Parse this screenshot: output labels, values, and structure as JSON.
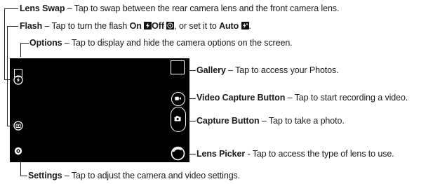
{
  "annotations": {
    "lens_swap": {
      "title": "Lens Swap",
      "desc": " – Tap to swap between the rear camera lens and the front camera lens."
    },
    "flash": {
      "title": "Flash",
      "desc_1": " – Tap to turn the flash ",
      "on_label": "On",
      "off_label": "Off",
      "desc_2": ", or set it to ",
      "auto_label": "Auto",
      "end": "."
    },
    "options": {
      "title": "Options",
      "desc": " – Tap to display and hide the camera options on the screen."
    },
    "gallery": {
      "title": "Gallery",
      "desc": " – Tap to access your Photos."
    },
    "video_capture": {
      "title": "Video Capture Button",
      "desc": " – Tap to start recording a video."
    },
    "capture": {
      "title": "Capture Button",
      "desc": " – Tap to take a photo."
    },
    "lens_picker": {
      "title": "Lens Picker",
      "desc": " - Tap to access the type of lens to use."
    },
    "settings": {
      "title": "Settings",
      "desc": " – Tap to adjust the camera and video settings."
    }
  },
  "icons": {
    "flash_on": "flash-on-icon",
    "flash_off": "flash-off-icon",
    "flash_auto": "flash-auto-icon",
    "options": "options-square-icon",
    "lens_swap": "lens-swap-icon",
    "flash": "flash-icon",
    "settings": "gear-icon",
    "gallery": "gallery-thumbnail",
    "video": "video-camera-icon",
    "camera": "camera-icon",
    "lens_picker": "lens-picker-icon"
  },
  "colors": {
    "screen": "#000000",
    "text": "#1a1a1a",
    "icon": "#ffffff"
  }
}
